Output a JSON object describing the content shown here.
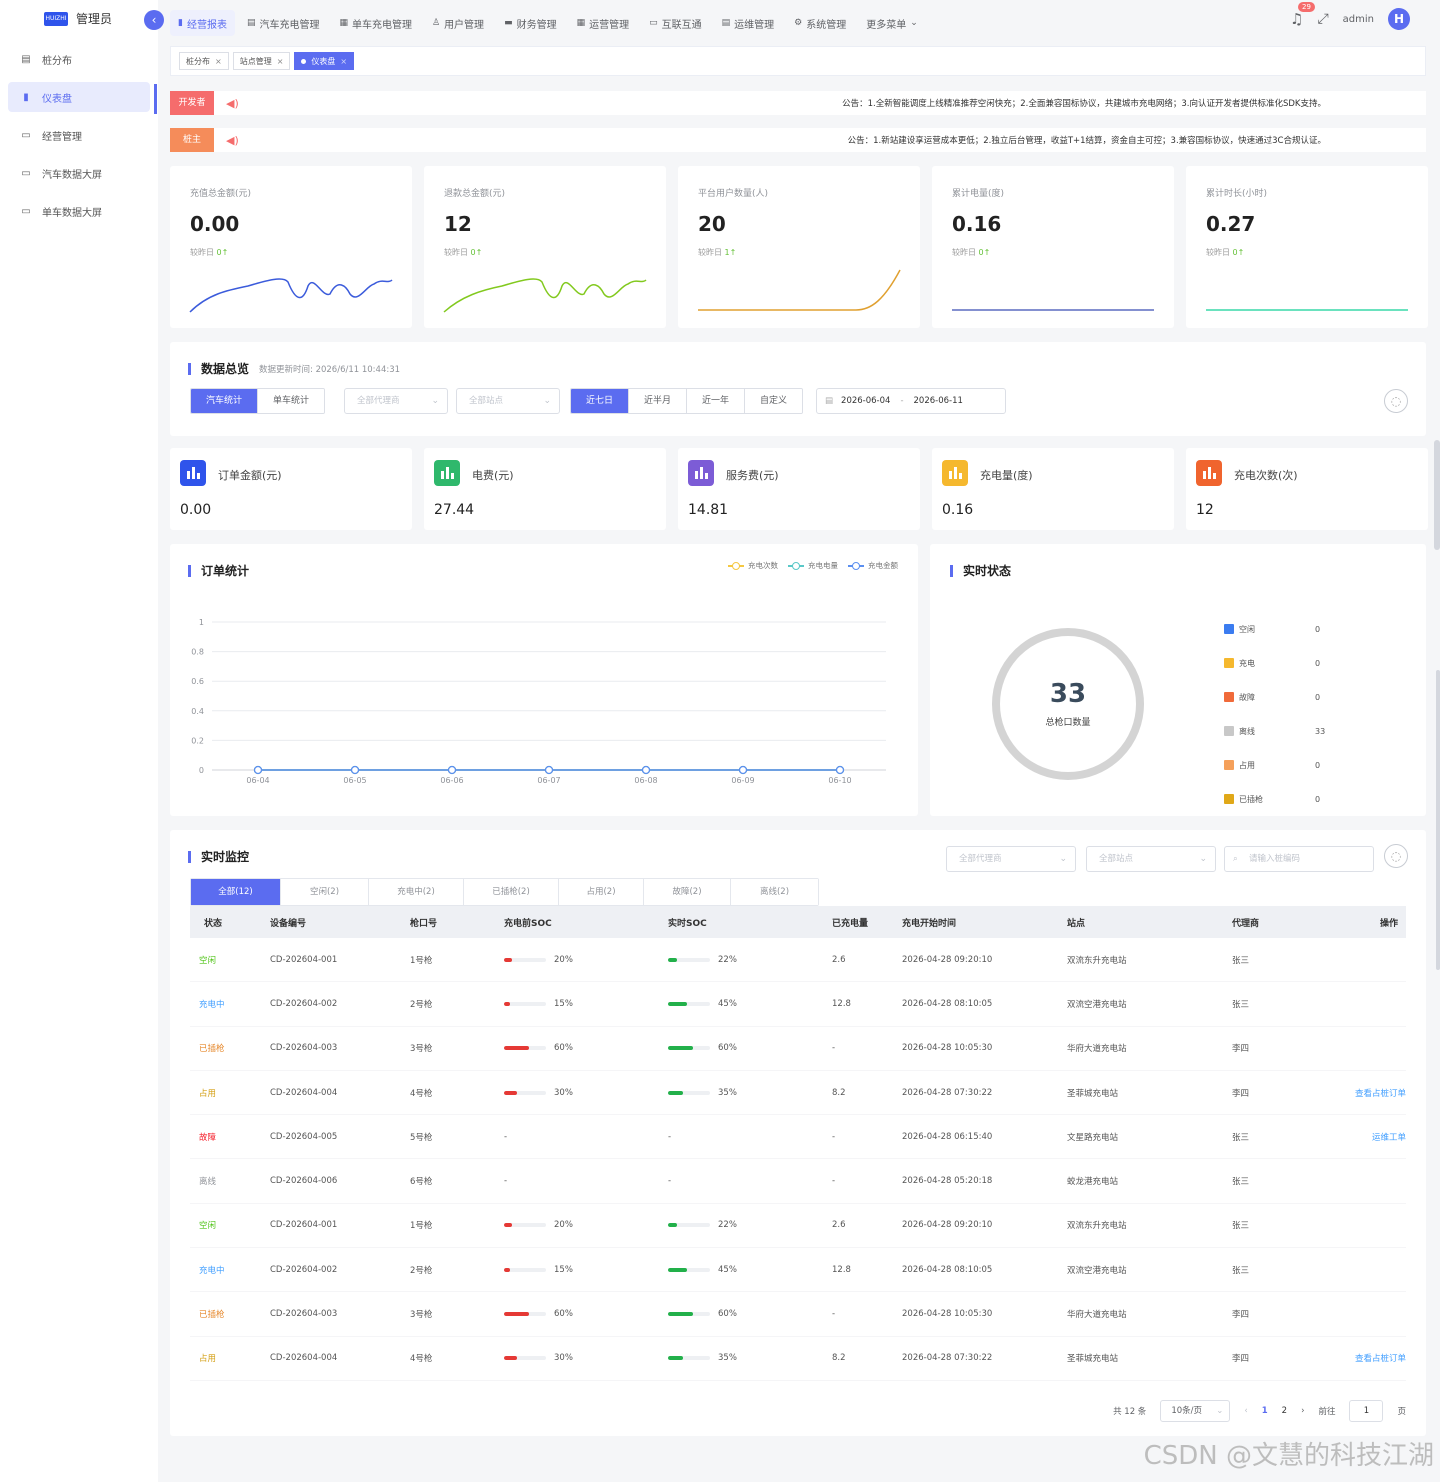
{
  "sidebar": {
    "logo_badge": "HUIZHI",
    "logo_text": "管理员",
    "items": [
      {
        "label": "桩分布",
        "icon": "map-icon"
      },
      {
        "label": "仪表盘",
        "icon": "bar-chart-icon",
        "active": true
      },
      {
        "label": "经营管理",
        "icon": "monitor-icon"
      },
      {
        "label": "汽车数据大屏",
        "icon": "screen-icon"
      },
      {
        "label": "单车数据大屏",
        "icon": "screen-icon"
      }
    ]
  },
  "topnav": {
    "items": [
      {
        "label": "经营报表",
        "icon": "bar-chart-icon",
        "active": true
      },
      {
        "label": "汽车充电管理",
        "icon": "list-icon"
      },
      {
        "label": "单车充电管理",
        "icon": "document-icon"
      },
      {
        "label": "用户管理",
        "icon": "users-icon"
      },
      {
        "label": "财务管理",
        "icon": "finance-icon"
      },
      {
        "label": "运营管理",
        "icon": "grid-icon"
      },
      {
        "label": "互联互通",
        "icon": "monitor-icon"
      },
      {
        "label": "运维管理",
        "icon": "tools-icon"
      },
      {
        "label": "系统管理",
        "icon": "gear-icon"
      },
      {
        "label": "更多菜单",
        "icon": "chevron-down-icon"
      }
    ],
    "notification_count": "29",
    "username": "admin",
    "avatar_letter": "H"
  },
  "tabs": [
    {
      "label": "桩分布",
      "active": false
    },
    {
      "label": "站点管理",
      "active": false
    },
    {
      "label": "仪表盘",
      "active": true
    }
  ],
  "notices": [
    {
      "label": "开发者",
      "color": "#f56c6c",
      "text": "公告：1.全新智能调度上线精准推荐空闲快充；2.全面兼容国标协议，共建城市充电网络；3.向认证开发者提供标准化SDK支持。"
    },
    {
      "label": "桩主",
      "color": "#f58c5a",
      "text": "公告：1.新站建设享运营成本更低；2.独立后台管理，收益T+1结算，资金自主可控；3.兼容国标协议，快速通过3C合规认证。"
    }
  ],
  "kpis": [
    {
      "title": "充值总金额(元)",
      "value": "0.00",
      "compare_label": "较昨日",
      "compare_value": "0",
      "color": "#3b5bdb"
    },
    {
      "title": "退款总金额(元)",
      "value": "12",
      "compare_label": "较昨日",
      "compare_value": "0",
      "color": "#82c91e"
    },
    {
      "title": "平台用户数量(人)",
      "value": "20",
      "compare_label": "较昨日",
      "compare_value": "1",
      "color": "#e0a030"
    },
    {
      "title": "累计电量(度)",
      "value": "0.16",
      "compare_label": "较昨日",
      "compare_value": "0",
      "color": "#5c6bc0"
    },
    {
      "title": "累计时长(小时)",
      "value": "0.27",
      "compare_label": "较昨日",
      "compare_value": "0",
      "color": "#38d9a9"
    }
  ],
  "overview": {
    "title": "数据总览",
    "updated": "数据更新时间: 2026/6/11 10:44:31",
    "type_tabs": [
      "汽车统计",
      "单车统计"
    ],
    "agent_placeholder": "全部代理商",
    "station_placeholder": "全部站点",
    "range_tabs": [
      "近七日",
      "近半月",
      "近一年",
      "自定义"
    ],
    "date_start": "2026-06-04",
    "date_sep": "-",
    "date_end": "2026-06-11"
  },
  "stats": [
    {
      "title": "订单金额(元)",
      "value": "0.00",
      "color": "#2f54eb"
    },
    {
      "title": "电费(元)",
      "value": "27.44",
      "color": "#2fb86c"
    },
    {
      "title": "服务费(元)",
      "value": "14.81",
      "color": "#7c5cd6"
    },
    {
      "title": "充电量(度)",
      "value": "0.16",
      "color": "#f5b82e"
    },
    {
      "title": "充电次数(次)",
      "value": "12",
      "color": "#f0642e"
    }
  ],
  "order_chart": {
    "title": "订单统计"
  },
  "chart_data": {
    "type": "line",
    "x": [
      "06-04",
      "06-05",
      "06-06",
      "06-07",
      "06-08",
      "06-09",
      "06-10"
    ],
    "ylim": [
      0,
      1
    ],
    "yticks": [
      "0",
      "0.2",
      "0.4",
      "0.6",
      "0.8",
      "1"
    ],
    "grid": true,
    "legend_position": "top-right",
    "series": [
      {
        "name": "充电次数",
        "color": "#f5c842",
        "values": [
          0,
          0,
          0,
          0,
          0,
          0,
          0
        ]
      },
      {
        "name": "充电电量",
        "color": "#5ac8c8",
        "values": [
          0,
          0,
          0,
          0,
          0,
          0,
          0
        ]
      },
      {
        "name": "充电金额",
        "color": "#5b8ff0",
        "values": [
          0,
          0,
          0,
          0,
          0,
          0,
          0
        ]
      }
    ]
  },
  "realtime_status": {
    "title": "实时状态",
    "total": "33",
    "total_label": "总枪口数量",
    "items": [
      {
        "name": "空闲",
        "count": "0",
        "color": "#3b7cf0"
      },
      {
        "name": "充电",
        "count": "0",
        "color": "#f5b82e"
      },
      {
        "name": "故障",
        "count": "0",
        "color": "#f06a3a"
      },
      {
        "name": "离线",
        "count": "33",
        "color": "#c8c8c8"
      },
      {
        "name": "占用",
        "count": "0",
        "color": "#f5a05a"
      },
      {
        "name": "已插枪",
        "count": "0",
        "color": "#e0a818"
      }
    ]
  },
  "monitor": {
    "title": "实时监控",
    "agent_placeholder": "全部代理商",
    "station_placeholder": "全部站点",
    "search_placeholder": "请输入桩编码",
    "tabs": [
      "全部(12)",
      "空闲(2)",
      "充电中(2)",
      "已插枪(2)",
      "占用(2)",
      "故障(2)",
      "离线(2)"
    ],
    "columns": [
      "状态",
      "设备编号",
      "枪口号",
      "充电前SOC",
      "实时SOC",
      "已充电量",
      "充电开始时间",
      "站点",
      "代理商",
      "操作"
    ],
    "rows": [
      {
        "status": "空闲",
        "status_color": "#52c41a",
        "device": "CD-202604-001",
        "gun": "1号枪",
        "soc_before": "20%",
        "soc_before_fill": 0.2,
        "soc_now": "22%",
        "soc_now_fill": 0.22,
        "charged": "2.6",
        "start": "2026-04-28 09:20:10",
        "station": "双流东升充电站",
        "agent": "张三",
        "op": ""
      },
      {
        "status": "充电中",
        "status_color": "#409eff",
        "device": "CD-202604-002",
        "gun": "2号枪",
        "soc_before": "15%",
        "soc_before_fill": 0.15,
        "soc_now": "45%",
        "soc_now_fill": 0.45,
        "charged": "12.8",
        "start": "2026-04-28 08:10:05",
        "station": "双流空港充电站",
        "agent": "张三",
        "op": ""
      },
      {
        "status": "已插枪",
        "status_color": "#e6892e",
        "device": "CD-202604-003",
        "gun": "3号枪",
        "soc_before": "60%",
        "soc_before_fill": 0.6,
        "soc_now": "60%",
        "soc_now_fill": 0.6,
        "charged": "-",
        "start": "2026-04-28 10:05:30",
        "station": "华府大道充电站",
        "agent": "李四",
        "op": ""
      },
      {
        "status": "占用",
        "status_color": "#d4a017",
        "device": "CD-202604-004",
        "gun": "4号枪",
        "soc_before": "30%",
        "soc_before_fill": 0.3,
        "soc_now": "35%",
        "soc_now_fill": 0.35,
        "charged": "8.2",
        "start": "2026-04-28 07:30:22",
        "station": "圣菲城充电站",
        "agent": "李四",
        "op": "查看占桩订单"
      },
      {
        "status": "故障",
        "status_color": "#f5222d",
        "device": "CD-202604-005",
        "gun": "5号枪",
        "soc_before": "-",
        "soc_now": "-",
        "charged": "-",
        "start": "2026-04-28 06:15:40",
        "station": "文星路充电站",
        "agent": "张三",
        "op": "运维工单"
      },
      {
        "status": "离线",
        "status_color": "#909399",
        "device": "CD-202604-006",
        "gun": "6号枪",
        "soc_before": "-",
        "soc_now": "-",
        "charged": "-",
        "start": "2026-04-28 05:20:18",
        "station": "蛟龙港充电站",
        "agent": "张三",
        "op": ""
      },
      {
        "status": "空闲",
        "status_color": "#52c41a",
        "device": "CD-202604-001",
        "gun": "1号枪",
        "soc_before": "20%",
        "soc_before_fill": 0.2,
        "soc_now": "22%",
        "soc_now_fill": 0.22,
        "charged": "2.6",
        "start": "2026-04-28 09:20:10",
        "station": "双流东升充电站",
        "agent": "张三",
        "op": ""
      },
      {
        "status": "充电中",
        "status_color": "#409eff",
        "device": "CD-202604-002",
        "gun": "2号枪",
        "soc_before": "15%",
        "soc_before_fill": 0.15,
        "soc_now": "45%",
        "soc_now_fill": 0.45,
        "charged": "12.8",
        "start": "2026-04-28 08:10:05",
        "station": "双流空港充电站",
        "agent": "张三",
        "op": ""
      },
      {
        "status": "已插枪",
        "status_color": "#e6892e",
        "device": "CD-202604-003",
        "gun": "3号枪",
        "soc_before": "60%",
        "soc_before_fill": 0.6,
        "soc_now": "60%",
        "soc_now_fill": 0.6,
        "charged": "-",
        "start": "2026-04-28 10:05:30",
        "station": "华府大道充电站",
        "agent": "李四",
        "op": ""
      },
      {
        "status": "占用",
        "status_color": "#d4a017",
        "device": "CD-202604-004",
        "gun": "4号枪",
        "soc_before": "30%",
        "soc_before_fill": 0.3,
        "soc_now": "35%",
        "soc_now_fill": 0.35,
        "charged": "8.2",
        "start": "2026-04-28 07:30:22",
        "station": "圣菲城充电站",
        "agent": "李四",
        "op": "查看占桩订单"
      }
    ],
    "pagination": {
      "total_text": "共 12 条",
      "page_size": "10条/页",
      "pages": [
        "1",
        "2"
      ],
      "current": "1",
      "goto_label": "前往",
      "goto_value": "1",
      "page_suffix": "页"
    }
  },
  "watermark": "CSDN @文慧的科技江湖"
}
